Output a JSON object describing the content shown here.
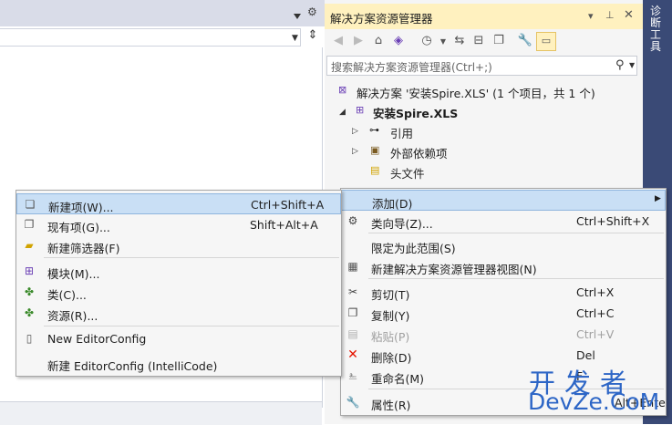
{
  "left_panel": {
    "gear_icon": "gear-icon",
    "split_icon": "split-icon"
  },
  "solution_explorer": {
    "title": "解决方案资源管理器",
    "vertical_tab": "诊断工具",
    "search_placeholder": "搜索解决方案资源管理器(Ctrl+;)",
    "tree": {
      "solution": "解决方案 '安装Spire.XLS' (1 个项目，共 1 个)",
      "project": "安装Spire.XLS",
      "references": "引用",
      "external_deps": "外部依赖项",
      "header_files": "头文件"
    }
  },
  "context_menu": {
    "items": [
      {
        "label": "添加(D)",
        "shortcut": "",
        "submenu": true
      },
      {
        "label": "类向导(Z)...",
        "shortcut": "Ctrl+Shift+X"
      },
      {
        "label": "限定为此范围(S)",
        "shortcut": ""
      },
      {
        "label": "新建解决方案资源管理器视图(N)",
        "shortcut": ""
      },
      {
        "label": "剪切(T)",
        "shortcut": "Ctrl+X"
      },
      {
        "label": "复制(Y)",
        "shortcut": "Ctrl+C"
      },
      {
        "label": "粘贴(P)",
        "shortcut": "Ctrl+V",
        "disabled": true
      },
      {
        "label": "删除(D)",
        "shortcut": "Del"
      },
      {
        "label": "重命名(M)",
        "shortcut": "F"
      },
      {
        "label": "属性(R)",
        "shortcut": "Alt+Ente"
      }
    ]
  },
  "submenu": {
    "items": [
      {
        "label": "新建项(W)...",
        "shortcut": "Ctrl+Shift+A"
      },
      {
        "label": "现有项(G)...",
        "shortcut": "Shift+Alt+A"
      },
      {
        "label": "新建筛选器(F)",
        "shortcut": ""
      },
      {
        "label": "模块(M)...",
        "shortcut": ""
      },
      {
        "label": "类(C)...",
        "shortcut": ""
      },
      {
        "label": "资源(R)...",
        "shortcut": ""
      },
      {
        "label": "New EditorConfig",
        "shortcut": ""
      },
      {
        "label": "新建 EditorConfig (IntelliCode)",
        "shortcut": ""
      }
    ]
  },
  "watermark": {
    "line1": "开发者",
    "line2": "DevZe.CoM"
  },
  "colors": {
    "title_active": "#fff1bf",
    "vertical_strip": "#3a4a76",
    "selection": "#c9dff5",
    "watermark": "#2d66c6"
  }
}
